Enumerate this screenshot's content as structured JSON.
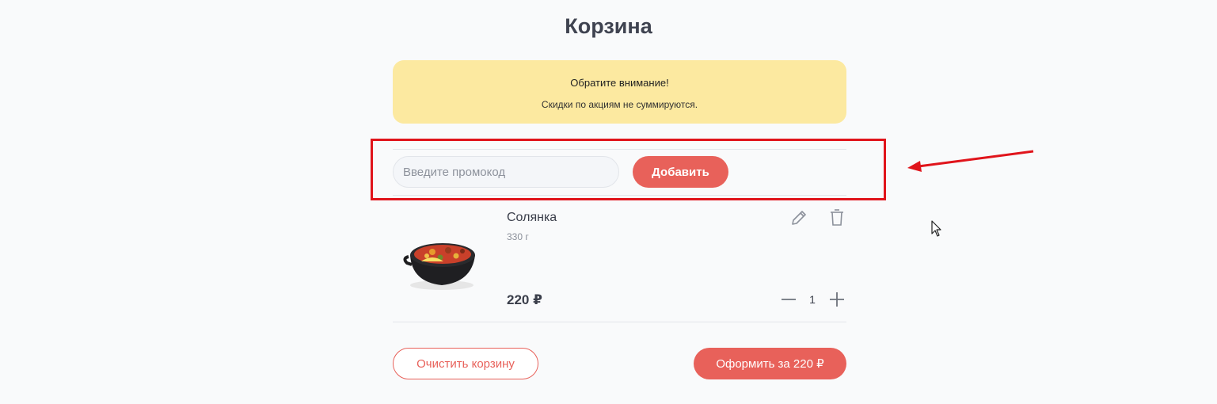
{
  "page": {
    "title": "Корзина"
  },
  "notice": {
    "title": "Обратите внимание!",
    "text": "Скидки по акциям не суммируются."
  },
  "promo": {
    "placeholder": "Введите промокод",
    "value": "",
    "add_label": "Добавить"
  },
  "cart": {
    "items": [
      {
        "name": "Солянка",
        "weight": "330 г",
        "price": "220 ₽",
        "quantity": "1",
        "image_icon": "soup-bowl-image",
        "actions": [
          "pencil-icon",
          "trash-icon"
        ],
        "quantity_icons": [
          "minus-icon",
          "plus-icon"
        ]
      }
    ]
  },
  "actions": {
    "clear_label": "Очистить корзину",
    "checkout_label": "Оформить за 220 ₽"
  },
  "colors": {
    "accent": "#e8615a",
    "notice_bg": "#fce9a0",
    "annotation": "#e0141b",
    "background": "#f9fafb"
  }
}
